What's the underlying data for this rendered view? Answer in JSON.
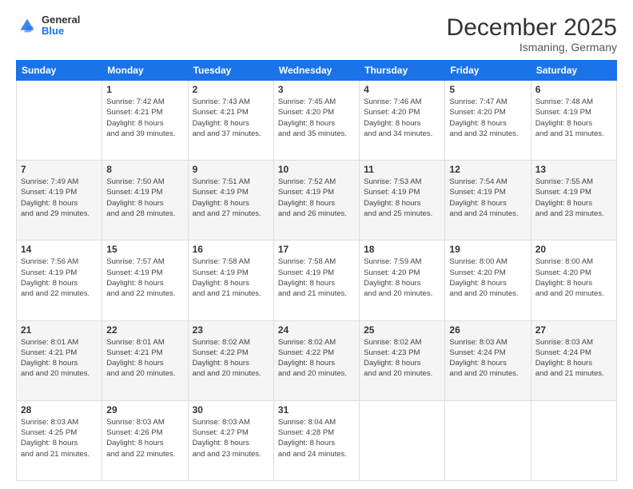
{
  "header": {
    "logo_general": "General",
    "logo_blue": "Blue",
    "month_year": "December 2025",
    "location": "Ismaning, Germany"
  },
  "days_of_week": [
    "Sunday",
    "Monday",
    "Tuesday",
    "Wednesday",
    "Thursday",
    "Friday",
    "Saturday"
  ],
  "weeks": [
    [
      {
        "day": "",
        "sunrise": "",
        "sunset": "",
        "daylight": ""
      },
      {
        "day": "1",
        "sunrise": "Sunrise: 7:42 AM",
        "sunset": "Sunset: 4:21 PM",
        "daylight": "Daylight: 8 hours and 39 minutes."
      },
      {
        "day": "2",
        "sunrise": "Sunrise: 7:43 AM",
        "sunset": "Sunset: 4:21 PM",
        "daylight": "Daylight: 8 hours and 37 minutes."
      },
      {
        "day": "3",
        "sunrise": "Sunrise: 7:45 AM",
        "sunset": "Sunset: 4:20 PM",
        "daylight": "Daylight: 8 hours and 35 minutes."
      },
      {
        "day": "4",
        "sunrise": "Sunrise: 7:46 AM",
        "sunset": "Sunset: 4:20 PM",
        "daylight": "Daylight: 8 hours and 34 minutes."
      },
      {
        "day": "5",
        "sunrise": "Sunrise: 7:47 AM",
        "sunset": "Sunset: 4:20 PM",
        "daylight": "Daylight: 8 hours and 32 minutes."
      },
      {
        "day": "6",
        "sunrise": "Sunrise: 7:48 AM",
        "sunset": "Sunset: 4:19 PM",
        "daylight": "Daylight: 8 hours and 31 minutes."
      }
    ],
    [
      {
        "day": "7",
        "sunrise": "Sunrise: 7:49 AM",
        "sunset": "Sunset: 4:19 PM",
        "daylight": "Daylight: 8 hours and 29 minutes."
      },
      {
        "day": "8",
        "sunrise": "Sunrise: 7:50 AM",
        "sunset": "Sunset: 4:19 PM",
        "daylight": "Daylight: 8 hours and 28 minutes."
      },
      {
        "day": "9",
        "sunrise": "Sunrise: 7:51 AM",
        "sunset": "Sunset: 4:19 PM",
        "daylight": "Daylight: 8 hours and 27 minutes."
      },
      {
        "day": "10",
        "sunrise": "Sunrise: 7:52 AM",
        "sunset": "Sunset: 4:19 PM",
        "daylight": "Daylight: 8 hours and 26 minutes."
      },
      {
        "day": "11",
        "sunrise": "Sunrise: 7:53 AM",
        "sunset": "Sunset: 4:19 PM",
        "daylight": "Daylight: 8 hours and 25 minutes."
      },
      {
        "day": "12",
        "sunrise": "Sunrise: 7:54 AM",
        "sunset": "Sunset: 4:19 PM",
        "daylight": "Daylight: 8 hours and 24 minutes."
      },
      {
        "day": "13",
        "sunrise": "Sunrise: 7:55 AM",
        "sunset": "Sunset: 4:19 PM",
        "daylight": "Daylight: 8 hours and 23 minutes."
      }
    ],
    [
      {
        "day": "14",
        "sunrise": "Sunrise: 7:56 AM",
        "sunset": "Sunset: 4:19 PM",
        "daylight": "Daylight: 8 hours and 22 minutes."
      },
      {
        "day": "15",
        "sunrise": "Sunrise: 7:57 AM",
        "sunset": "Sunset: 4:19 PM",
        "daylight": "Daylight: 8 hours and 22 minutes."
      },
      {
        "day": "16",
        "sunrise": "Sunrise: 7:58 AM",
        "sunset": "Sunset: 4:19 PM",
        "daylight": "Daylight: 8 hours and 21 minutes."
      },
      {
        "day": "17",
        "sunrise": "Sunrise: 7:58 AM",
        "sunset": "Sunset: 4:19 PM",
        "daylight": "Daylight: 8 hours and 21 minutes."
      },
      {
        "day": "18",
        "sunrise": "Sunrise: 7:59 AM",
        "sunset": "Sunset: 4:20 PM",
        "daylight": "Daylight: 8 hours and 20 minutes."
      },
      {
        "day": "19",
        "sunrise": "Sunrise: 8:00 AM",
        "sunset": "Sunset: 4:20 PM",
        "daylight": "Daylight: 8 hours and 20 minutes."
      },
      {
        "day": "20",
        "sunrise": "Sunrise: 8:00 AM",
        "sunset": "Sunset: 4:20 PM",
        "daylight": "Daylight: 8 hours and 20 minutes."
      }
    ],
    [
      {
        "day": "21",
        "sunrise": "Sunrise: 8:01 AM",
        "sunset": "Sunset: 4:21 PM",
        "daylight": "Daylight: 8 hours and 20 minutes."
      },
      {
        "day": "22",
        "sunrise": "Sunrise: 8:01 AM",
        "sunset": "Sunset: 4:21 PM",
        "daylight": "Daylight: 8 hours and 20 minutes."
      },
      {
        "day": "23",
        "sunrise": "Sunrise: 8:02 AM",
        "sunset": "Sunset: 4:22 PM",
        "daylight": "Daylight: 8 hours and 20 minutes."
      },
      {
        "day": "24",
        "sunrise": "Sunrise: 8:02 AM",
        "sunset": "Sunset: 4:22 PM",
        "daylight": "Daylight: 8 hours and 20 minutes."
      },
      {
        "day": "25",
        "sunrise": "Sunrise: 8:02 AM",
        "sunset": "Sunset: 4:23 PM",
        "daylight": "Daylight: 8 hours and 20 minutes."
      },
      {
        "day": "26",
        "sunrise": "Sunrise: 8:03 AM",
        "sunset": "Sunset: 4:24 PM",
        "daylight": "Daylight: 8 hours and 20 minutes."
      },
      {
        "day": "27",
        "sunrise": "Sunrise: 8:03 AM",
        "sunset": "Sunset: 4:24 PM",
        "daylight": "Daylight: 8 hours and 21 minutes."
      }
    ],
    [
      {
        "day": "28",
        "sunrise": "Sunrise: 8:03 AM",
        "sunset": "Sunset: 4:25 PM",
        "daylight": "Daylight: 8 hours and 21 minutes."
      },
      {
        "day": "29",
        "sunrise": "Sunrise: 8:03 AM",
        "sunset": "Sunset: 4:26 PM",
        "daylight": "Daylight: 8 hours and 22 minutes."
      },
      {
        "day": "30",
        "sunrise": "Sunrise: 8:03 AM",
        "sunset": "Sunset: 4:27 PM",
        "daylight": "Daylight: 8 hours and 23 minutes."
      },
      {
        "day": "31",
        "sunrise": "Sunrise: 8:04 AM",
        "sunset": "Sunset: 4:28 PM",
        "daylight": "Daylight: 8 hours and 24 minutes."
      },
      {
        "day": "",
        "sunrise": "",
        "sunset": "",
        "daylight": ""
      },
      {
        "day": "",
        "sunrise": "",
        "sunset": "",
        "daylight": ""
      },
      {
        "day": "",
        "sunrise": "",
        "sunset": "",
        "daylight": ""
      }
    ]
  ]
}
